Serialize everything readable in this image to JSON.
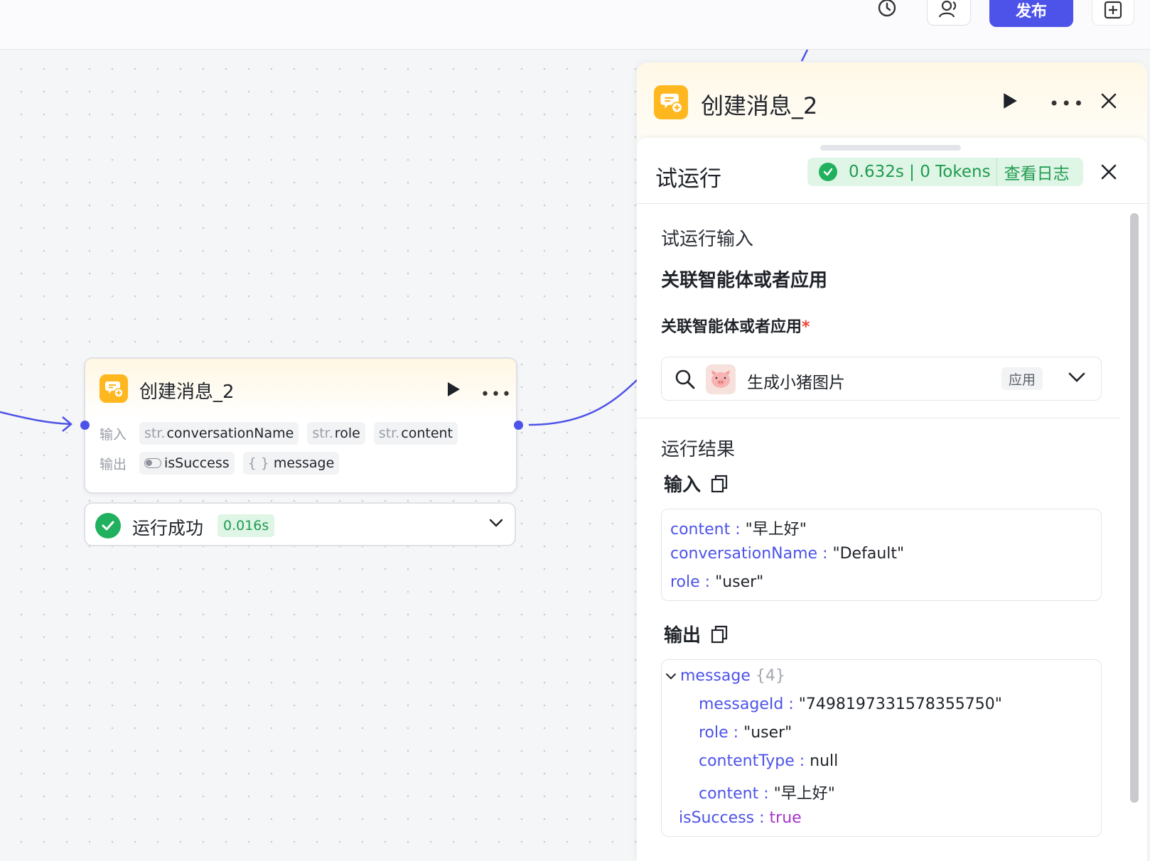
{
  "topbar": {
    "publish_label": "发布"
  },
  "node": {
    "title": "创建消息_2",
    "input_label": "输入",
    "output_label": "输出",
    "inputs": [
      {
        "type": "str.",
        "name": "conversationName"
      },
      {
        "type": "str.",
        "name": "role"
      },
      {
        "type": "str.",
        "name": "content"
      }
    ],
    "outputs": [
      {
        "type": "toggle",
        "name": "isSuccess"
      },
      {
        "type": "{ }",
        "name": "message"
      }
    ]
  },
  "run_result": {
    "status": "运行成功",
    "time": "0.016s"
  },
  "panel": {
    "title": "创建消息_2",
    "trial": {
      "title": "试运行",
      "stats": "0.632s | 0 Tokens",
      "view_log": "查看日志"
    },
    "trial_input_heading": "试运行输入",
    "field_title": "关联智能体或者应用",
    "field_label": "关联智能体或者应用",
    "required_mark": "*",
    "selected": {
      "name": "生成小猪图片",
      "tag": "应用"
    },
    "result_heading": "运行结果",
    "input_heading": "输入",
    "output_heading": "输出",
    "input_values": [
      {
        "key": "content",
        "value": "\"早上好\""
      },
      {
        "key": "conversationName",
        "value": "\"Default\""
      },
      {
        "key": "role",
        "value": "\"user\""
      }
    ],
    "output": {
      "message_key": "message",
      "message_count": "{4}",
      "message_fields": [
        {
          "key": "messageId",
          "value": "\"7498197331578355750\""
        },
        {
          "key": "role",
          "value": "\"user\""
        },
        {
          "key": "contentType",
          "value": "null"
        },
        {
          "key": "content",
          "value": "\"早上好\""
        }
      ],
      "success_key": "isSuccess",
      "success_value": "true"
    }
  },
  "colors": {
    "accent": "#4d53e8",
    "node_icon": "#ffb71f",
    "success": "#21b15e",
    "success_text": "#1f9b4f"
  },
  "icons": [
    "history-icon",
    "users-icon",
    "add-panel-icon",
    "message-plus-icon",
    "play-icon",
    "more-icon",
    "close-icon",
    "check-icon",
    "chevron-down-icon",
    "search-icon",
    "pig-avatar-icon",
    "copy-icon",
    "toggle-icon"
  ]
}
